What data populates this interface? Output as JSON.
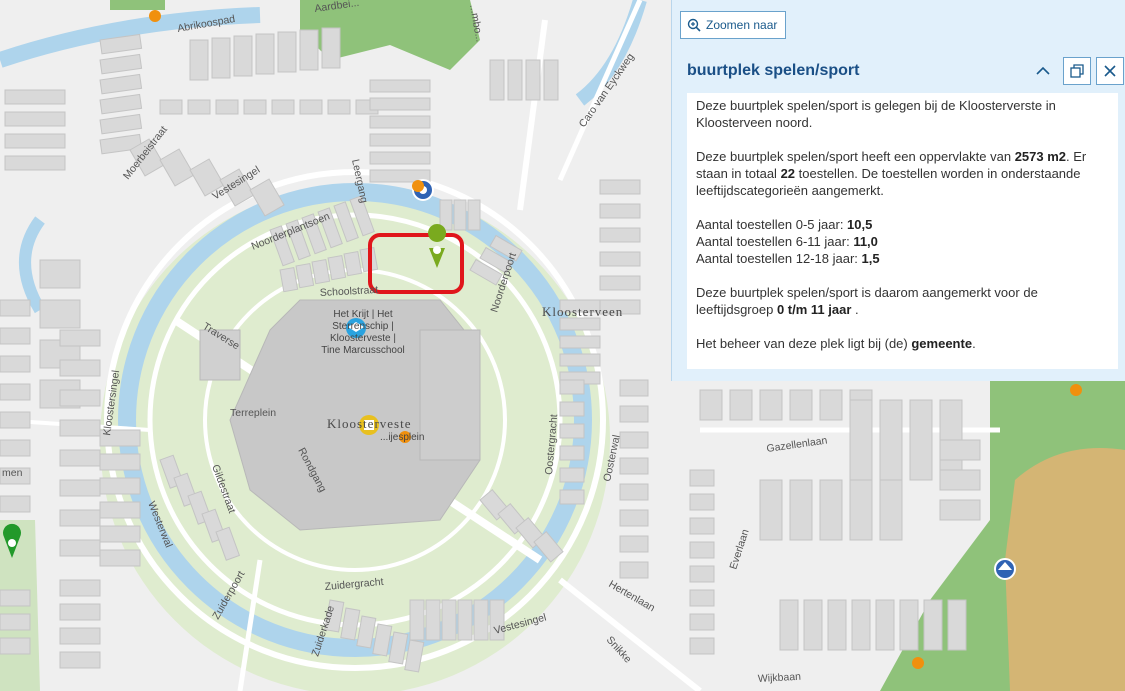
{
  "map": {
    "street_labels": {
      "abrikoospad": "Abrikoospad",
      "moerbeistraat": "Moerbeistraat",
      "vestesingel_nw": "Vestesingel",
      "leergang": "Leergang",
      "noorderplantsoen": "Noorderplantsoen",
      "schoolstraat": "Schoolstraat",
      "noorderpoort": "Noorderpoort",
      "traverse": "Traverse",
      "kloostersingel": "Kloostersingel",
      "terreplein": "Terreplein",
      "rondgang": "Rondgang",
      "gildestraat": "Gildestraat",
      "westerwal": "Westerwal",
      "zuiderpoort": "Zuiderpoort",
      "zuidergracht": "Zuidergracht",
      "zuiderkade": "Zuiderkade",
      "vestesingel_s": "Vestesingel",
      "oostergracht": "Oostergracht",
      "oosterwal": "Oosterwal",
      "everlaan": "Everlaan",
      "gazellenlaan": "Gazellenlaan",
      "hertenlaan": "Hertenlaan",
      "snikke": "Snikke",
      "wijkbaan": "Wijkbaan",
      "caro_van_eyckweg": "Caro van Eyckweg",
      "aardbeilaan": "Aardbei...",
      "imbo": "...mbo...",
      "men": "men"
    },
    "district_label": "Kloosterveen",
    "mall_label": "Kloosterveste",
    "mall_sub_label": "...ijesplein",
    "school_label_lines": [
      "Het Krijt | Het",
      "Sterrenschip |",
      "Kloosterveste |",
      "Tine Marcusschool"
    ]
  },
  "popup": {
    "zoom_label": "Zoomen naar",
    "title": "buurtplek spelen/sport",
    "p1": "Deze buurtplek spelen/sport is gelegen bij de Kloosterverste in Kloosterveen noord.",
    "p2_pre": "Deze buurtplek spelen/sport heeft een oppervlakte van ",
    "p2_area": "2573 m2",
    "p2_mid": ". Er staan in totaal ",
    "p2_count": "22",
    "p2_post": " toestellen. De toestellen worden in onderstaande leeftijdscategorieën aangemerkt.",
    "age1_label": "Aantal toestellen 0-5 jaar: ",
    "age1_value": "10,5",
    "age2_label": "Aantal toestellen 6-11 jaar: ",
    "age2_value": "11,0",
    "age3_label": "Aantal toestellen 12-18 jaar: ",
    "age3_value": "1,5",
    "p4_pre": "Deze buurtplek spelen/sport is daarom aangemerkt voor de leeftijdsgroep ",
    "p4_group": "0 t/m 11 jaar",
    "p4_post": " .",
    "p5_pre": "Het beheer van deze plek ligt bij (de) ",
    "p5_owner": "gemeente",
    "p5_post": "."
  },
  "colors": {
    "water": "#aed4ec",
    "park": "#8fc27a",
    "highlight": "#e0161b",
    "popup_bg": "#e1f0fb",
    "title": "#1a4f86"
  },
  "icons": {
    "zoom": "zoom-in-icon",
    "collapse": "chevron-up-icon",
    "dock": "dock-icon",
    "close": "close-icon"
  }
}
